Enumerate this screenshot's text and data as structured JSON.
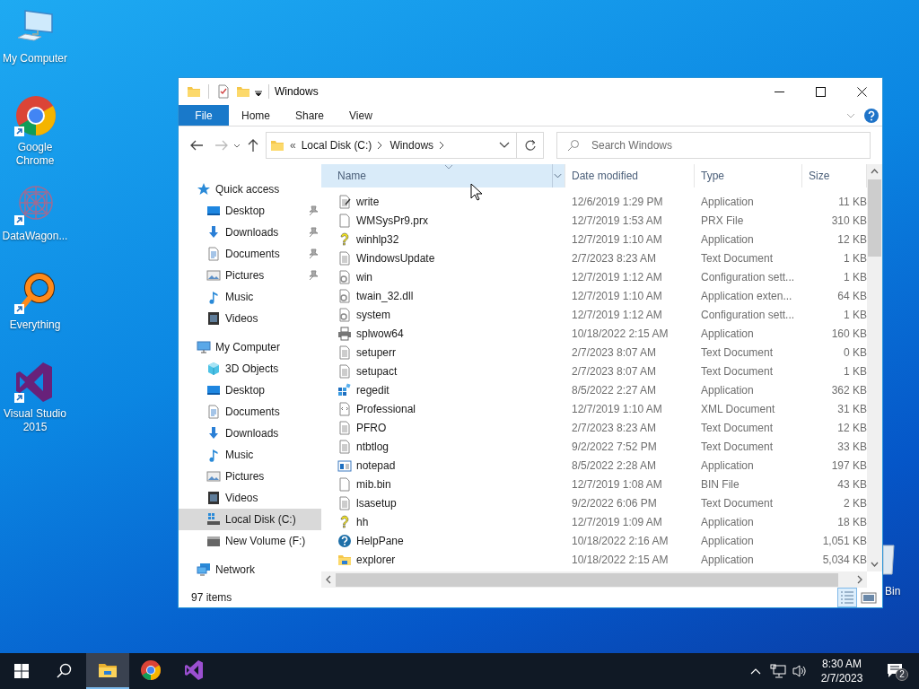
{
  "desktop": {
    "shortcuts": [
      {
        "label": "My Computer",
        "kind": "computer",
        "shortcut": false
      },
      {
        "label": "Google Chrome",
        "kind": "chrome",
        "shortcut": true
      },
      {
        "label": "DataWagon...",
        "kind": "datawagon",
        "shortcut": true
      },
      {
        "label": "Everything",
        "kind": "everything",
        "shortcut": true
      },
      {
        "label": "Visual Studio 2015",
        "kind": "visual-studio",
        "shortcut": true
      }
    ],
    "partial_shortcut": {
      "label": "Bin"
    }
  },
  "window": {
    "title": "Windows",
    "ribbon": {
      "file_button": "File",
      "tabs": [
        "Home",
        "Share",
        "View"
      ]
    },
    "address": {
      "overflow": "«",
      "path": [
        "Local Disk (C:)",
        "Windows"
      ]
    },
    "search": {
      "placeholder": "Search Windows"
    },
    "navigation": [
      {
        "label": "Quick access",
        "kind": "star",
        "selected": false,
        "children": [
          {
            "label": "Desktop",
            "kind": "desktop",
            "pinned": true,
            "selected": false
          },
          {
            "label": "Downloads",
            "kind": "download",
            "pinned": true,
            "selected": false
          },
          {
            "label": "Documents",
            "kind": "documents",
            "pinned": true,
            "selected": false
          },
          {
            "label": "Pictures",
            "kind": "pictures",
            "pinned": true,
            "selected": false
          },
          {
            "label": "Music",
            "kind": "music",
            "pinned": false,
            "selected": false
          },
          {
            "label": "Videos",
            "kind": "videos",
            "pinned": false,
            "selected": false
          }
        ]
      },
      {
        "label": "My Computer",
        "kind": "computer",
        "selected": false,
        "children": [
          {
            "label": "3D Objects",
            "kind": "cube",
            "selected": false
          },
          {
            "label": "Desktop",
            "kind": "desktop",
            "selected": false
          },
          {
            "label": "Documents",
            "kind": "documents",
            "selected": false
          },
          {
            "label": "Downloads",
            "kind": "download",
            "selected": false
          },
          {
            "label": "Music",
            "kind": "music",
            "selected": false
          },
          {
            "label": "Pictures",
            "kind": "pictures",
            "selected": false
          },
          {
            "label": "Videos",
            "kind": "videos",
            "selected": false
          },
          {
            "label": "Local Disk (C:)",
            "kind": "disk",
            "selected": true
          },
          {
            "label": "New Volume (F:)",
            "kind": "drive",
            "selected": false
          }
        ]
      },
      {
        "label": "Network",
        "kind": "network",
        "selected": false
      }
    ],
    "columns": [
      {
        "label": "Name",
        "sorted": true
      },
      {
        "label": "Date modified",
        "sorted": false
      },
      {
        "label": "Type",
        "sorted": false
      },
      {
        "label": "Size",
        "sorted": false
      }
    ],
    "rows": [
      {
        "name": "write",
        "date_modified": "12/6/2019 1:29 PM",
        "type": "Application",
        "size": "11 KB",
        "kind": "write"
      },
      {
        "name": "WMSysPr9.prx",
        "date_modified": "12/7/2019 1:53 AM",
        "type": "PRX File",
        "size": "310 KB",
        "kind": "blank"
      },
      {
        "name": "winhlp32",
        "date_modified": "12/7/2019 1:10 AM",
        "type": "Application",
        "size": "12 KB",
        "kind": "help"
      },
      {
        "name": "WindowsUpdate",
        "date_modified": "2/7/2023 8:23 AM",
        "type": "Text Document",
        "size": "1 KB",
        "kind": "text"
      },
      {
        "name": "win",
        "date_modified": "12/7/2019 1:12 AM",
        "type": "Configuration sett...",
        "size": "1 KB",
        "kind": "config"
      },
      {
        "name": "twain_32.dll",
        "date_modified": "12/7/2019 1:10 AM",
        "type": "Application exten...",
        "size": "64 KB",
        "kind": "dll"
      },
      {
        "name": "system",
        "date_modified": "12/7/2019 1:12 AM",
        "type": "Configuration sett...",
        "size": "1 KB",
        "kind": "config"
      },
      {
        "name": "splwow64",
        "date_modified": "10/18/2022 2:15 AM",
        "type": "Application",
        "size": "160 KB",
        "kind": "printer"
      },
      {
        "name": "setuperr",
        "date_modified": "2/7/2023 8:07 AM",
        "type": "Text Document",
        "size": "0 KB",
        "kind": "text"
      },
      {
        "name": "setupact",
        "date_modified": "2/7/2023 8:07 AM",
        "type": "Text Document",
        "size": "1 KB",
        "kind": "text"
      },
      {
        "name": "regedit",
        "date_modified": "8/5/2022 2:27 AM",
        "type": "Application",
        "size": "362 KB",
        "kind": "regedit"
      },
      {
        "name": "Professional",
        "date_modified": "12/7/2019 1:10 AM",
        "type": "XML Document",
        "size": "31 KB",
        "kind": "xml"
      },
      {
        "name": "PFRO",
        "date_modified": "2/7/2023 8:23 AM",
        "type": "Text Document",
        "size": "12 KB",
        "kind": "text"
      },
      {
        "name": "ntbtlog",
        "date_modified": "9/2/2022 7:52 PM",
        "type": "Text Document",
        "size": "33 KB",
        "kind": "text"
      },
      {
        "name": "notepad",
        "date_modified": "8/5/2022 2:28 AM",
        "type": "Application",
        "size": "197 KB",
        "kind": "notepad"
      },
      {
        "name": "mib.bin",
        "date_modified": "12/7/2019 1:08 AM",
        "type": "BIN File",
        "size": "43 KB",
        "kind": "blank"
      },
      {
        "name": "lsasetup",
        "date_modified": "9/2/2022 6:06 PM",
        "type": "Text Document",
        "size": "2 KB",
        "kind": "text"
      },
      {
        "name": "hh",
        "date_modified": "12/7/2019 1:09 AM",
        "type": "Application",
        "size": "18 KB",
        "kind": "help"
      },
      {
        "name": "HelpPane",
        "date_modified": "10/18/2022 2:16 AM",
        "type": "Application",
        "size": "1,051 KB",
        "kind": "helppane"
      },
      {
        "name": "explorer",
        "date_modified": "10/18/2022 2:15 AM",
        "type": "Application",
        "size": "5,034 KB",
        "kind": "explorer"
      }
    ],
    "status_bar": {
      "item_count": "97 items",
      "views": [
        {
          "kind": "details",
          "selected": true
        },
        {
          "kind": "large-icons",
          "selected": false
        }
      ]
    }
  },
  "taskbar": {
    "apps": [
      {
        "kind": "explorer",
        "active": true
      },
      {
        "kind": "chrome",
        "active": false
      },
      {
        "kind": "visual-studio",
        "active": false
      }
    ],
    "clock": {
      "time": "8:30 AM",
      "date": "2/7/2023"
    },
    "notifications": {
      "count": "2"
    }
  }
}
